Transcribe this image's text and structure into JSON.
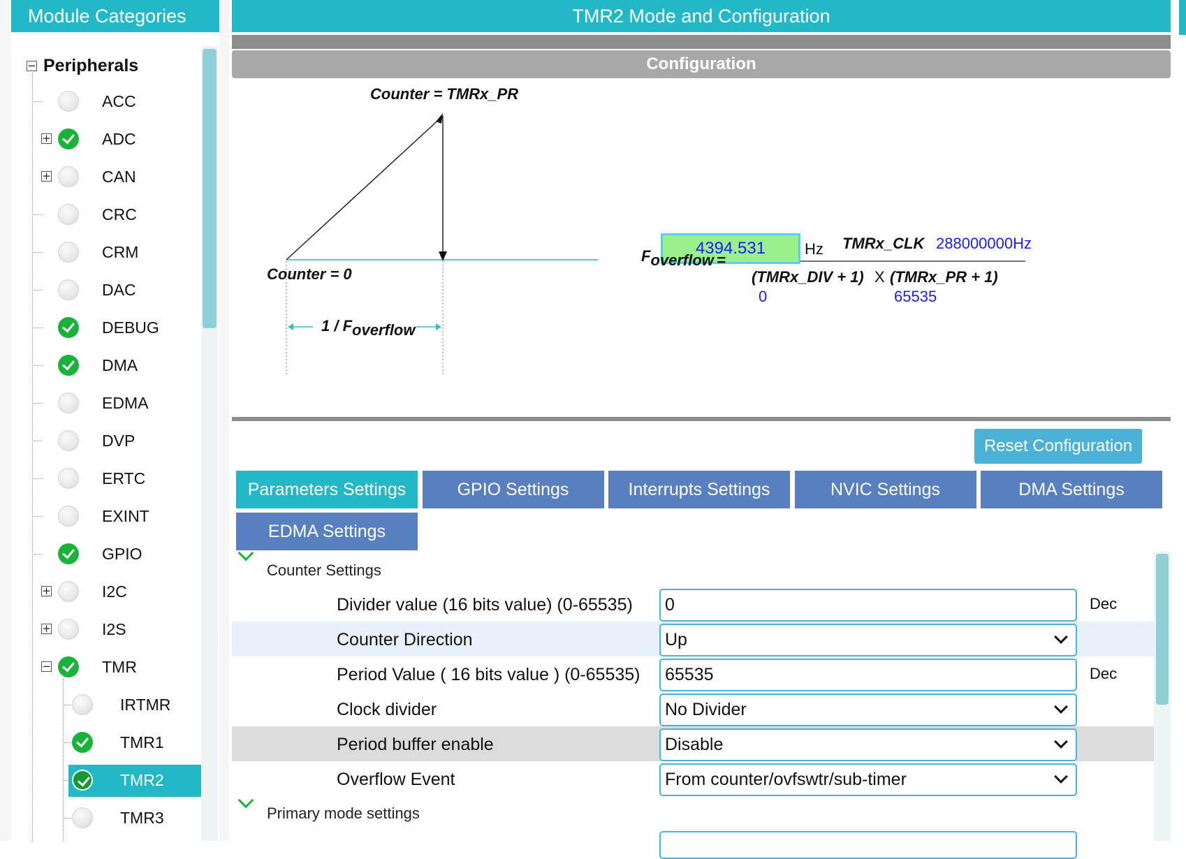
{
  "left_panel": {
    "title": "Module Categories",
    "root_label": "Peripherals",
    "items": [
      {
        "label": "ACC",
        "enabled": false,
        "expandable": false
      },
      {
        "label": "ADC",
        "enabled": true,
        "expandable": true
      },
      {
        "label": "CAN",
        "enabled": false,
        "expandable": true
      },
      {
        "label": "CRC",
        "enabled": false,
        "expandable": false
      },
      {
        "label": "CRM",
        "enabled": false,
        "expandable": false
      },
      {
        "label": "DAC",
        "enabled": false,
        "expandable": false
      },
      {
        "label": "DEBUG",
        "enabled": true,
        "expandable": false
      },
      {
        "label": "DMA",
        "enabled": true,
        "expandable": false
      },
      {
        "label": "EDMA",
        "enabled": false,
        "expandable": false
      },
      {
        "label": "DVP",
        "enabled": false,
        "expandable": false
      },
      {
        "label": "ERTC",
        "enabled": false,
        "expandable": false
      },
      {
        "label": "EXINT",
        "enabled": false,
        "expandable": false
      },
      {
        "label": "GPIO",
        "enabled": true,
        "expandable": false
      },
      {
        "label": "I2C",
        "enabled": false,
        "expandable": true
      },
      {
        "label": "I2S",
        "enabled": false,
        "expandable": true
      },
      {
        "label": "TMR",
        "enabled": true,
        "expandable": true,
        "expanded": true
      }
    ],
    "tmr_children": [
      {
        "label": "IRTMR",
        "enabled": false
      },
      {
        "label": "TMR1",
        "enabled": true
      },
      {
        "label": "TMR2",
        "enabled": true,
        "selected": true
      },
      {
        "label": "TMR3",
        "enabled": false
      }
    ]
  },
  "main": {
    "title": "TMR2 Mode and Configuration",
    "config_header": "Configuration",
    "diagram": {
      "counter_top": "Counter = TMRx_PR",
      "counter_zero": "Counter = 0",
      "period_label": "1 / F",
      "period_sub": "overflow",
      "f_overflow": "4394.531",
      "hz": "Hz",
      "f_label": "F",
      "f_sub": "overflow",
      "equals": "=",
      "clk_label": "TMRx_CLK",
      "clk_value": "288000000Hz",
      "div_label": "(TMRx_DIV + 1)",
      "times": "X",
      "pr_label": "(TMRx_PR + 1)",
      "div_value": "0",
      "pr_value": "65535"
    },
    "reset_button": "Reset Configuration",
    "tabs": [
      {
        "label": "Parameters Settings",
        "active": true
      },
      {
        "label": "GPIO Settings",
        "active": false
      },
      {
        "label": "Interrupts Settings",
        "active": false
      },
      {
        "label": "NVIC Settings",
        "active": false
      },
      {
        "label": "DMA Settings",
        "active": false
      },
      {
        "label": "EDMA Settings",
        "active": false
      }
    ],
    "sections": {
      "counter": "Counter Settings",
      "primary": "Primary mode settings"
    },
    "params": [
      {
        "label": "Divider value (16 bits value) (0-65535)",
        "value": "0",
        "type": "text",
        "unit": "Dec"
      },
      {
        "label": "Counter Direction",
        "value": "Up",
        "type": "select",
        "unit": ""
      },
      {
        "label": "Period Value ( 16 bits value ) (0-65535)",
        "value": "65535",
        "type": "text",
        "unit": "Dec"
      },
      {
        "label": "Clock divider",
        "value": "No Divider",
        "type": "select",
        "unit": ""
      },
      {
        "label": "Period buffer enable",
        "value": "Disable",
        "type": "select",
        "unit": ""
      },
      {
        "label": "Overflow Event",
        "value": "From counter/ovfswtr/sub-timer",
        "type": "select",
        "unit": ""
      }
    ]
  },
  "colors": {
    "accent": "#22b8c7",
    "tab": "#587fbf",
    "enabled": "#19b33a",
    "freq_box": "#9af08a",
    "value_text": "#1a1aff"
  }
}
